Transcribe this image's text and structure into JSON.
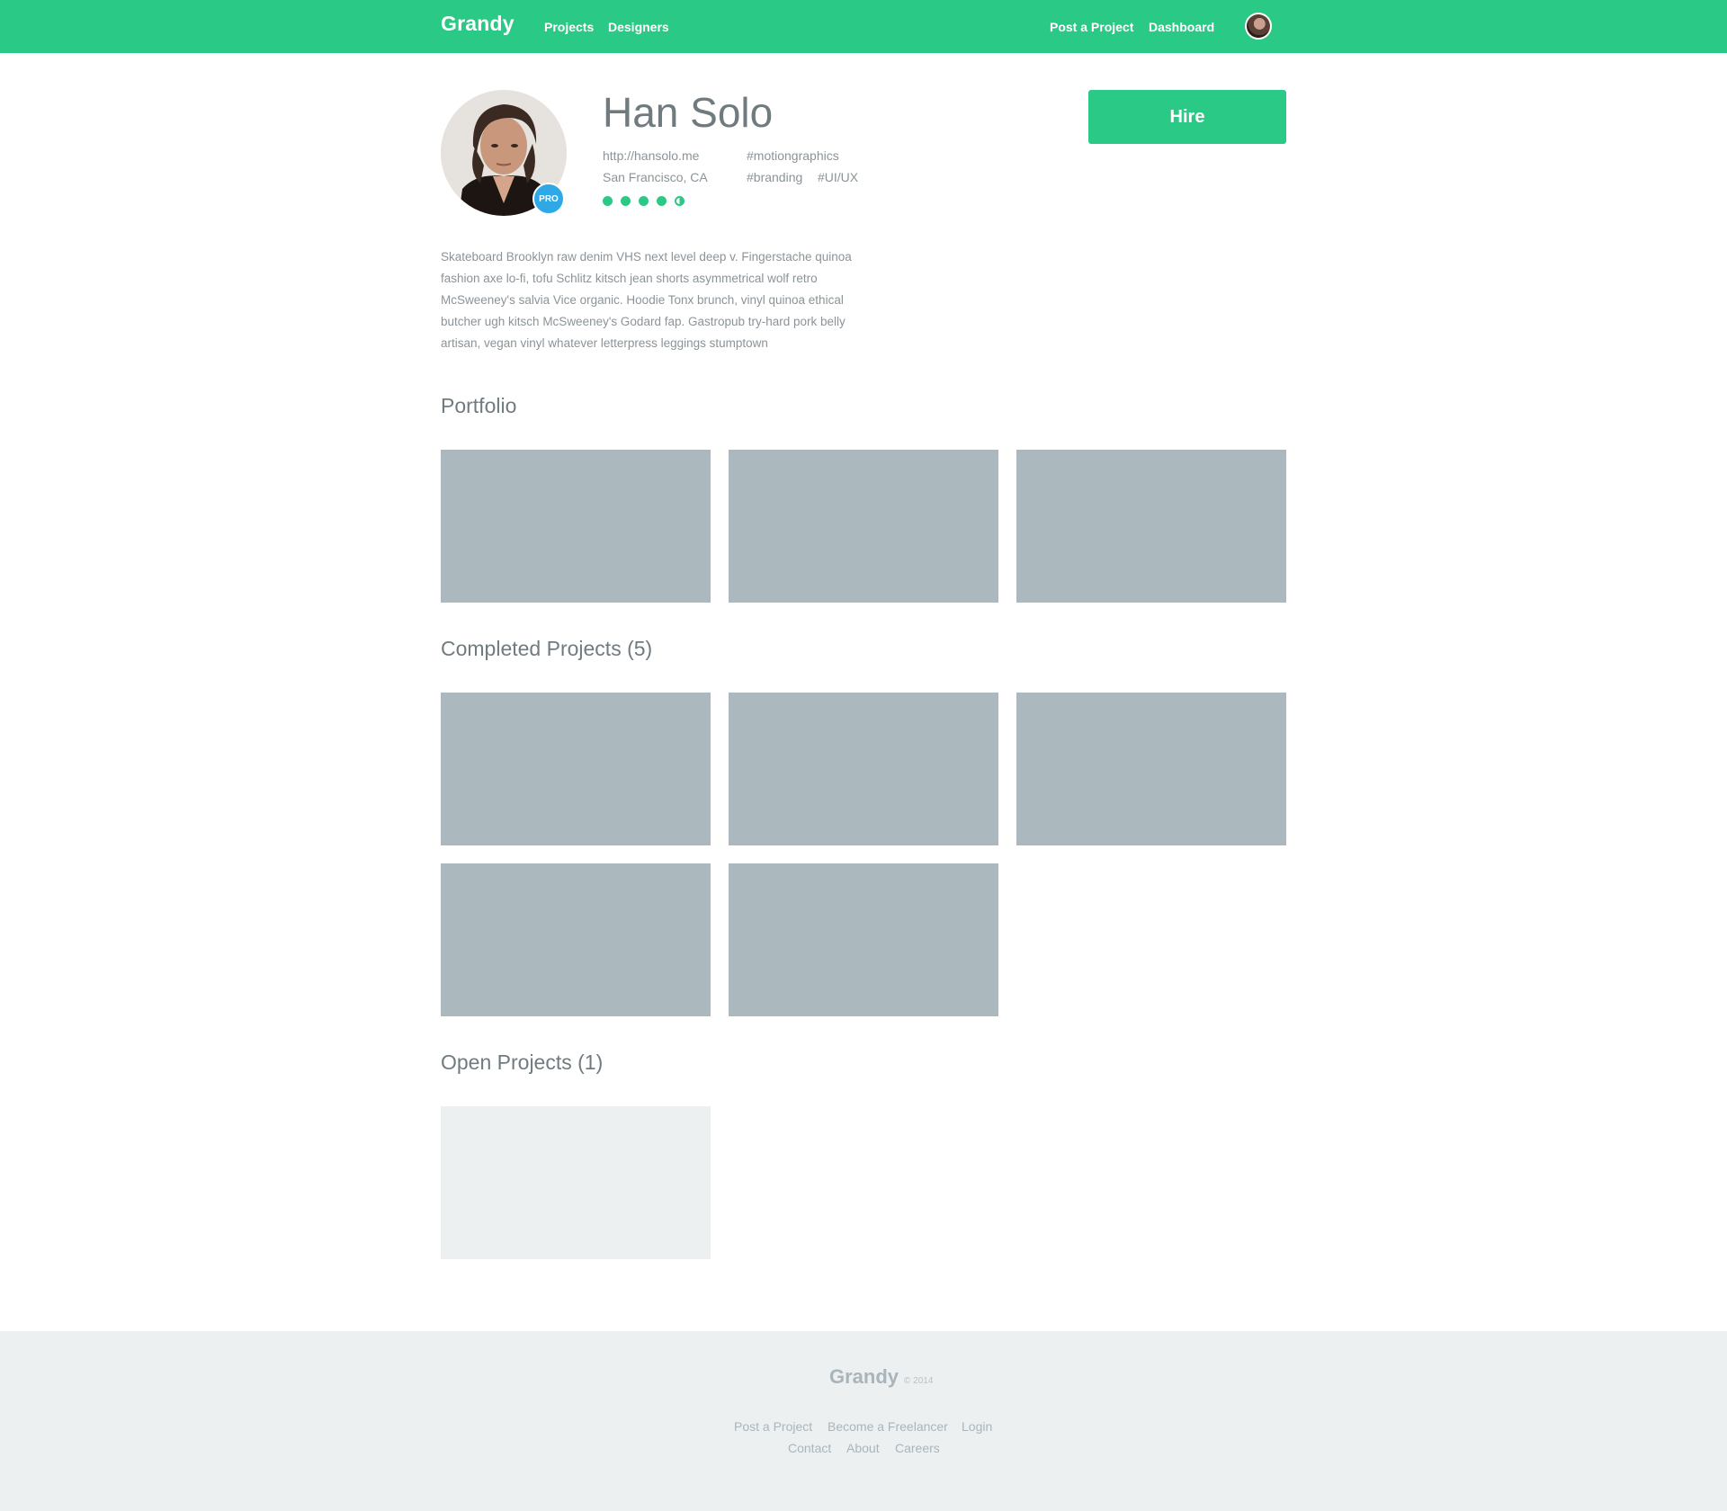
{
  "header": {
    "logo": "Grandy",
    "nav_left": [
      "Projects",
      "Designers"
    ],
    "nav_right": [
      "Post a Project",
      "Dashboard"
    ]
  },
  "profile": {
    "name": "Han Solo",
    "website": "http://hansolo.me",
    "location": "San Francisco, CA",
    "tags": [
      "#motiongraphics",
      "#branding",
      "#UI/UX"
    ],
    "badge": "PRO",
    "rating": 4.5,
    "hire_label": "Hire",
    "bio": "Skateboard Brooklyn raw denim VHS next level deep v. Fingerstache quinoa fashion axe lo-fi, tofu Schlitz kitsch jean shorts asymmetrical wolf retro McSweeney's salvia Vice organic. Hoodie Tonx brunch, vinyl quinoa ethical butcher ugh kitsch McSweeney's Godard fap. Gastropub try-hard pork belly artisan, vegan vinyl whatever letterpress leggings stumptown"
  },
  "sections": {
    "portfolio": "Portfolio",
    "completed": "Completed Projects (5)",
    "open": "Open Projects (1)"
  },
  "footer": {
    "logo": "Grandy",
    "copyright": "© 2014",
    "links_row1": [
      "Post a Project",
      "Become a Freelancer",
      "Login"
    ],
    "links_row2": [
      "Contact",
      "About",
      "Careers"
    ]
  },
  "colors": {
    "brand": "#2bc986",
    "pro_badge": "#2fa8e6",
    "placeholder": "#abb8be",
    "footer_bg": "#edf0f1"
  }
}
